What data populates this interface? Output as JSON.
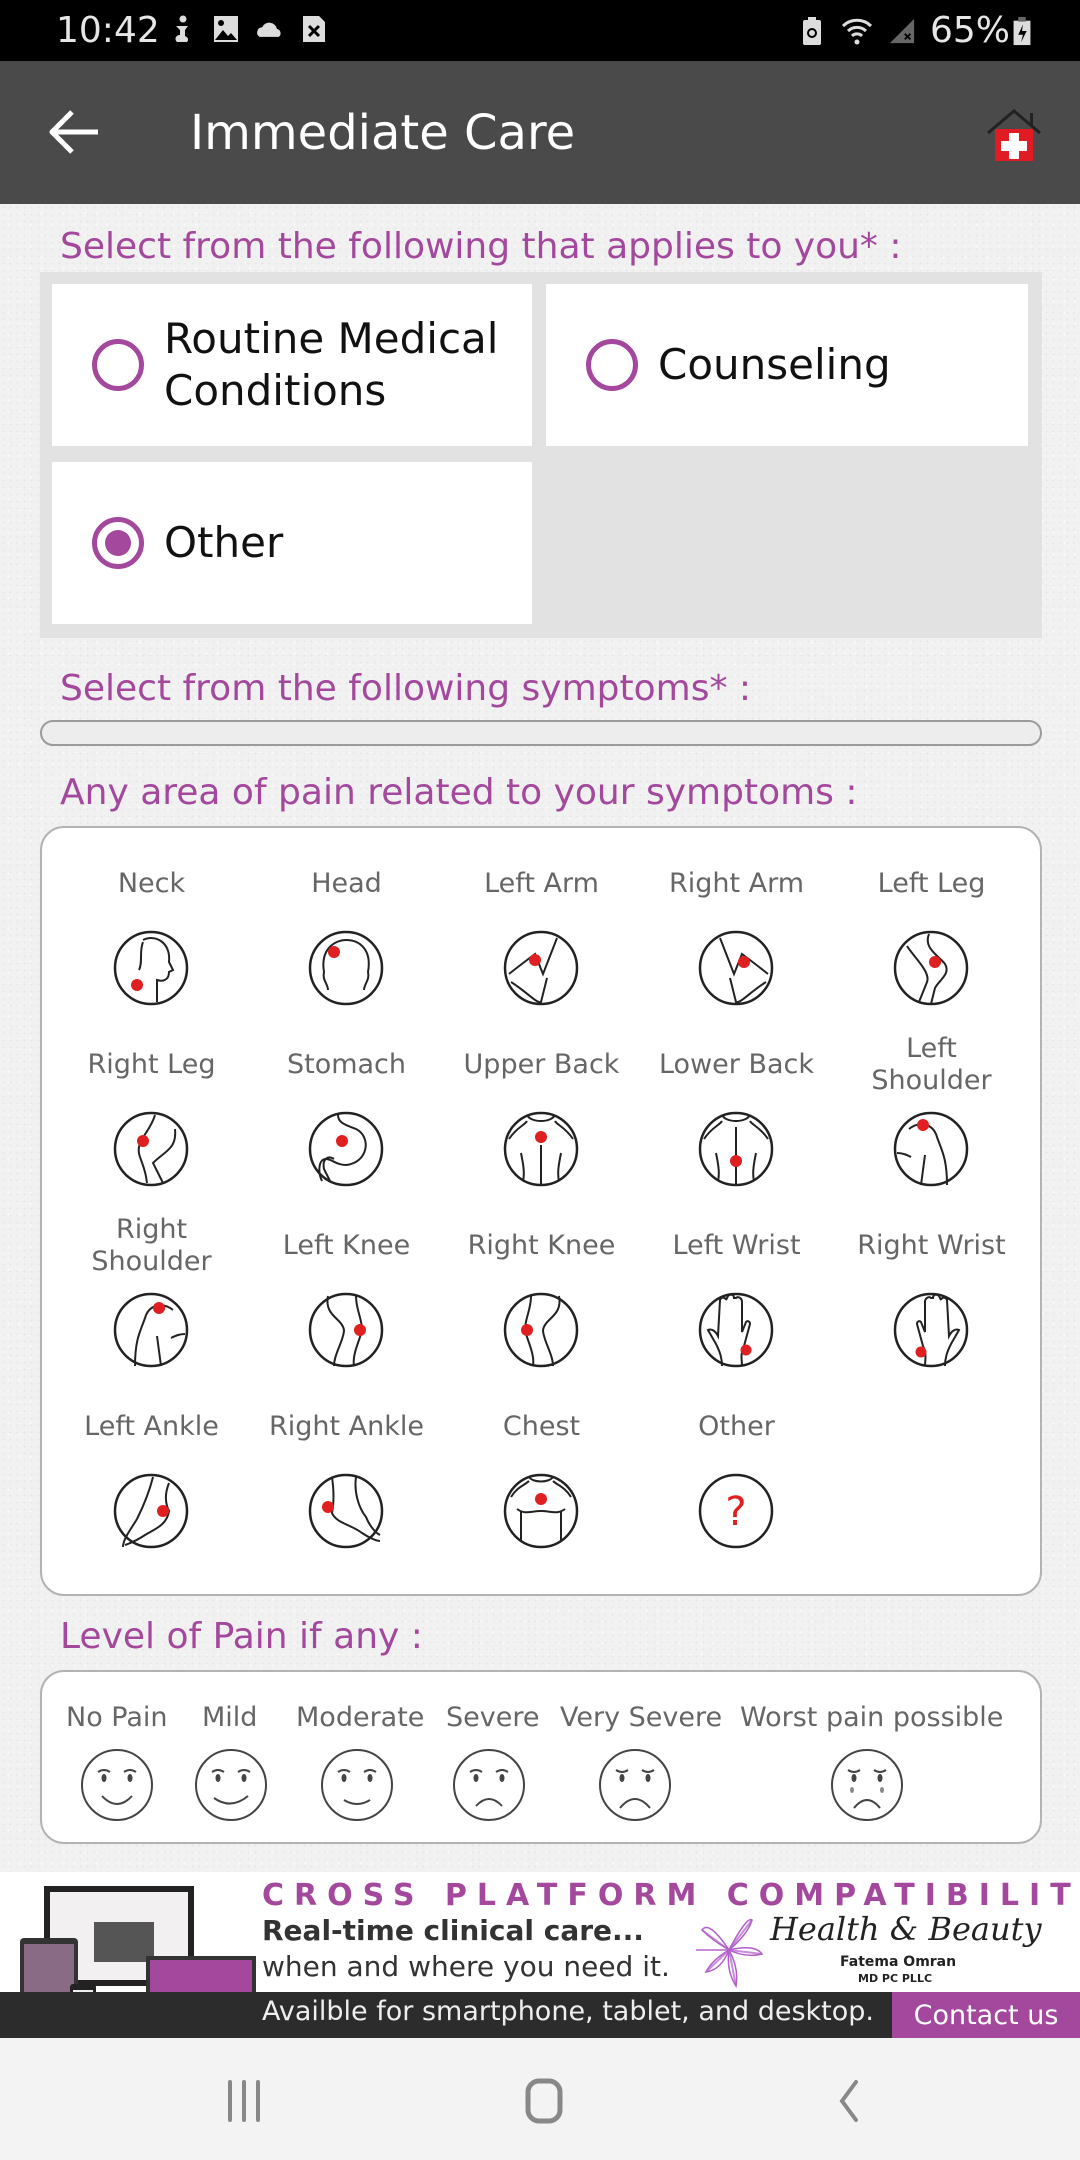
{
  "status_bar": {
    "time": "10:42",
    "left_icons": [
      "accessibility-icon",
      "image-icon",
      "cloud-icon",
      "sim-error-icon"
    ],
    "right_icons": [
      "battery-saver-icon",
      "wifi-icon",
      "signal-icon"
    ],
    "battery_percent": "65%"
  },
  "app_bar": {
    "title": "Immediate Care",
    "back_icon": "arrow-left-icon",
    "home_icon": "medical-home-icon"
  },
  "colors": {
    "accent": "#a3489c",
    "app_bar": "#4a4a4a",
    "pain_dot": "#e02020"
  },
  "applies_section": {
    "label": "Select from the following that applies to you* :",
    "options": [
      {
        "line1": "Routine Medical",
        "line2": "Conditions",
        "checked": false
      },
      {
        "line1": "Counseling",
        "line2": "",
        "checked": false
      },
      {
        "line1": "Other",
        "line2": "",
        "checked": true
      }
    ]
  },
  "symptoms_section": {
    "label": "Select from the following symptoms* :",
    "selected_value": ""
  },
  "pain_area_section": {
    "label": "Any area of pain related to your symptoms :",
    "areas": [
      {
        "l1": "Neck",
        "l2": ""
      },
      {
        "l1": "Head",
        "l2": ""
      },
      {
        "l1": "Left Arm",
        "l2": ""
      },
      {
        "l1": "Right Arm",
        "l2": ""
      },
      {
        "l1": "Left Leg",
        "l2": ""
      },
      {
        "l1": "Right Leg",
        "l2": ""
      },
      {
        "l1": "Stomach",
        "l2": ""
      },
      {
        "l1": "Upper Back",
        "l2": ""
      },
      {
        "l1": "Lower Back",
        "l2": ""
      },
      {
        "l1": "Left",
        "l2": "Shoulder"
      },
      {
        "l1": "Right",
        "l2": "Shoulder"
      },
      {
        "l1": "Left Knee",
        "l2": ""
      },
      {
        "l1": "Right Knee",
        "l2": ""
      },
      {
        "l1": "Left Wrist",
        "l2": ""
      },
      {
        "l1": "Right Wrist",
        "l2": ""
      },
      {
        "l1": "Left Ankle",
        "l2": ""
      },
      {
        "l1": "Right Ankle",
        "l2": ""
      },
      {
        "l1": "Chest",
        "l2": ""
      },
      {
        "l1": "Other",
        "l2": ""
      }
    ],
    "other_icon_glyph": "?"
  },
  "pain_level_section": {
    "label": "Level of Pain if any :",
    "levels": [
      "No Pain",
      "Mild",
      "Moderate",
      "Severe",
      "Very Severe",
      "Worst pain possible"
    ]
  },
  "banner": {
    "heading": "CROSS PLATFORM COMPATIBILITY",
    "line1": "Real-time clinical care...",
    "line2": "when and where you need it.",
    "brand": "Health & Beauty",
    "doctor": "Fatema Omran",
    "doctor_suffix": "MD PC PLLC",
    "availability": "Availble for smartphone, tablet, and desktop.",
    "contact": "Contact us"
  },
  "nav_bar": {
    "recents_icon": "recent-apps-icon",
    "home_icon": "home-button-icon",
    "back_icon": "back-nav-icon"
  }
}
